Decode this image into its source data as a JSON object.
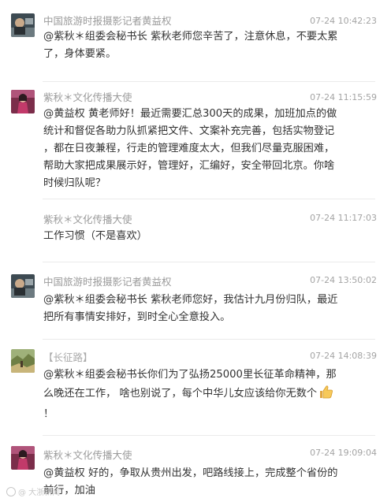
{
  "messages": [
    {
      "author": "中国旅游时报摄影记者黄益权",
      "time": "07-24 10:42:23",
      "avatar": "portrait-photo-avatar",
      "lines": [
        "@紫秋＊组委会秘书长 紫秋老师您辛苦了，注意休息，不要太累",
        "了，身体要紧。"
      ]
    },
    {
      "author": "紫秋＊文化传播大使",
      "time": "07-24 11:15:59",
      "avatar": "woman-photo-avatar",
      "lines": [
        "@黄益权 黄老师好！最近需要汇总300天的成果，加班加点的做",
        "统计和督促各助力队抓紧把文件、文案补充完善，包括实物登记",
        "，都在日夜兼程，行走的管理难度太大，但我们尽量克服困难，",
        "帮助大家把成果展示好，管理好，汇编好，安全带回北京。你啥",
        "时候归队呢？"
      ]
    },
    {
      "author": "紫秋＊文化传播大使",
      "time": "07-24 11:17:03",
      "avatar": "",
      "lines": [
        "工作习惯（不是喜欢）"
      ]
    },
    {
      "author": "中国旅游时报摄影记者黄益权",
      "time": "07-24 13:50:02",
      "avatar": "portrait-photo-avatar",
      "lines": [
        "@紫秋＊组委会秘书长 紫秋老师您好，我估计九月份归队，最近",
        "把所有事情安排好，到时全心全意投入。"
      ]
    },
    {
      "author": "【长征路】",
      "time": "07-24 14:08:39",
      "avatar": "landscape-photo-avatar",
      "lines": [
        "@紫秋＊组委会秘书长你们为了弘扬25000里长征革命精神，那",
        "么晚还在工作，  啥也别说了，每个中华儿女应该给你无数个",
        "！"
      ]
    },
    {
      "author": "紫秋＊文化传播大使",
      "time": "07-24 19:09:04",
      "avatar": "woman-photo-avatar",
      "lines": [
        "@黄益权 好的，争取从贵州出发，吧路线接上，完成整个省份的",
        "前行，加油"
      ]
    }
  ],
  "emoji": "thumbs-up-icon",
  "watermark": "@ 大浙新闻"
}
